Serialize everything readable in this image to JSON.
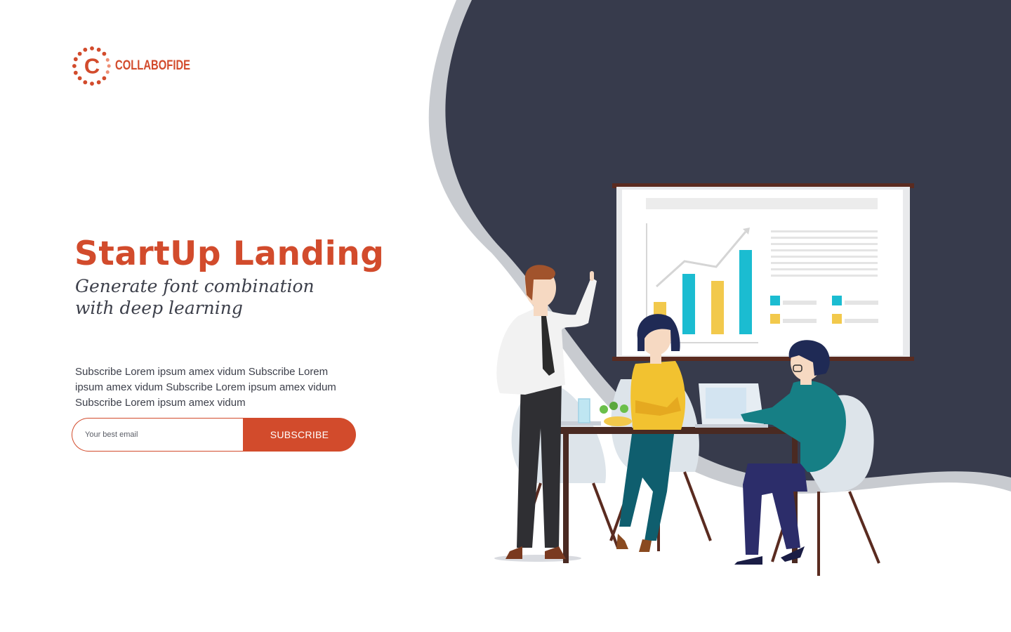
{
  "brand": {
    "logo_letter": "C",
    "name": "COLLABOFIDE",
    "color": "#d24b2c"
  },
  "hero": {
    "title": "StartUp Landing",
    "subtitle": "Generate font combination with deep learning",
    "body": "Subscribe Lorem ipsum amex vidum Subscribe Lorem ipsum amex vidum Subscribe Lorem ipsum amex vidum Subscribe Lorem ipsum amex vidum"
  },
  "subscribe": {
    "email_placeholder": "Your best email",
    "button_label": "SUBSCRIBE"
  },
  "illustration": {
    "icon": "team-meeting-illustration",
    "colors": {
      "navy_shape": "#373b4c",
      "grey_wave": "#c8cbd0",
      "accent_cyan": "#1bbcd1",
      "accent_yellow": "#f2c94c",
      "table_brown": "#4a2a22"
    }
  }
}
